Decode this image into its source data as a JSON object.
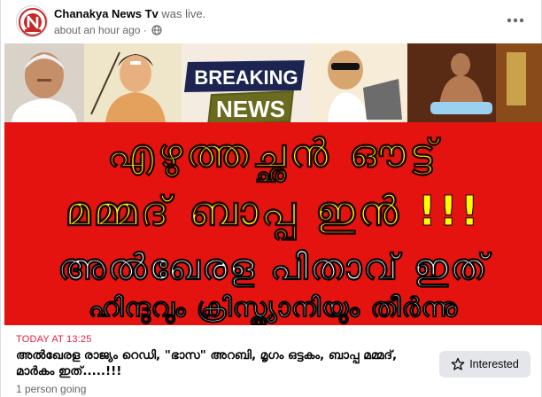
{
  "post": {
    "page_name": "Chanakya News Tv",
    "status": "was live.",
    "timestamp": "about an hour ago",
    "privacy_icon": "globe-icon",
    "more_icon": "more-horizontal-icon"
  },
  "thumbnail": {
    "banner_line1": "BREAKING",
    "banner_line2": "NEWS",
    "headline_line1": "എഴുത്തച്ഛൻ ഔട്ട്",
    "headline_line2": "മമ്മദ് ബാപ്പ ഇൻ !!!",
    "headline_line3": "അൽഖേരള പിതാവ് ഇത്",
    "headline_line4": "ഹിന്ദുവും ക്രിസ്ത്യാനിയും തീർന്നു"
  },
  "event": {
    "date": "TODAY AT 13:25",
    "title": "അൽഖേരള രാജ്യം റെഡി, \"ഭാസ\" അറബി, മൃഗം ഒട്ടകം, ബാപ്പ മമ്മദ്, മാർകം ഇത്.....!!!",
    "going": "1 person going",
    "interested_label": "Interested",
    "interested_icon": "star-icon"
  },
  "colors": {
    "accent_red": "#e41e3f",
    "thumbnail_red": "#e5130f",
    "headline_yellow": "#ffff00",
    "button_bg": "#e4e6eb"
  }
}
